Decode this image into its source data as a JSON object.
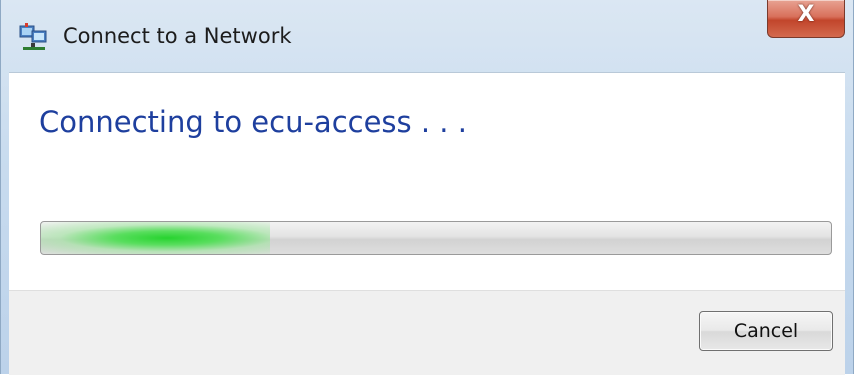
{
  "window": {
    "title": "Connect to a Network",
    "close_label": "X"
  },
  "content": {
    "heading": "Connecting to ecu-access . . ."
  },
  "progress": {
    "indeterminate": true,
    "glow_fraction": 0.29,
    "accent_color": "#27d32f"
  },
  "footer": {
    "cancel_label": "Cancel"
  }
}
